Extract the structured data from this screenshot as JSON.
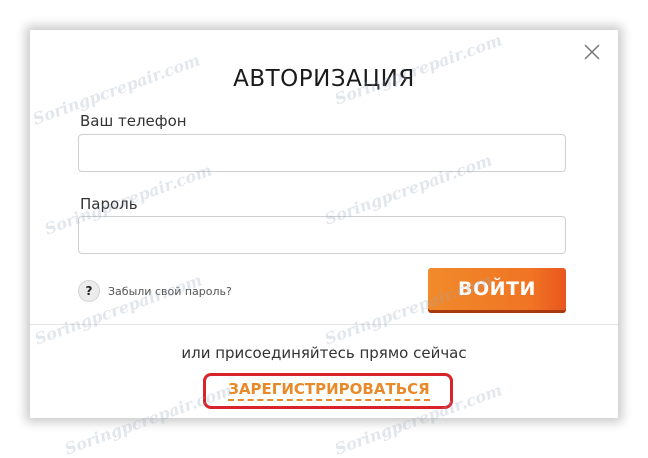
{
  "dialog": {
    "title": "АВТОРИЗАЦИЯ",
    "close_icon": "close-icon",
    "phone": {
      "label": "Ваш телефон",
      "value": "",
      "placeholder": ""
    },
    "password": {
      "label": "Пароль",
      "value": "",
      "placeholder": ""
    },
    "forgot": {
      "icon": "question-icon",
      "icon_glyph": "?",
      "text": "Забыли свой пароль?"
    },
    "login_button": "ВОЙТИ",
    "join_text": "или присоединяйтесь прямо сейчас",
    "register_link": "ЗАРЕГИСТРИРОВАТЬСЯ"
  },
  "watermark": "Soringpcrepair.com",
  "colors": {
    "accent": "#f07424",
    "link": "#e88a2a",
    "highlight": "#d8232a"
  }
}
